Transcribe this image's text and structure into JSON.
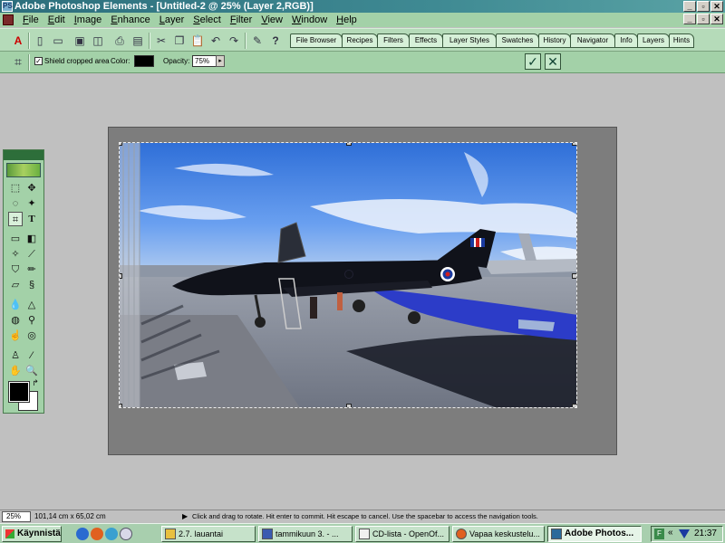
{
  "window": {
    "title": "Adobe Photoshop Elements - [Untitled-2 @ 25% (Layer 2,RGB)]",
    "controls": [
      "_",
      "▫",
      "✕"
    ],
    "doc_controls": [
      "_",
      "▫",
      "✕"
    ]
  },
  "menu": [
    {
      "label": "File",
      "u": "F",
      "rest": "ile"
    },
    {
      "label": "Edit",
      "u": "E",
      "rest": "dit"
    },
    {
      "label": "Image",
      "u": "I",
      "rest": "mage"
    },
    {
      "label": "Enhance",
      "u": "E",
      "rest": "nhance"
    },
    {
      "label": "Layer",
      "u": "L",
      "rest": "ayer"
    },
    {
      "label": "Select",
      "u": "S",
      "rest": "elect"
    },
    {
      "label": "Filter",
      "u": "F",
      "rest": "ilter"
    },
    {
      "label": "View",
      "u": "V",
      "rest": "iew"
    },
    {
      "label": "Window",
      "u": "W",
      "rest": "indow"
    },
    {
      "label": "Help",
      "u": "H",
      "rest": "elp"
    }
  ],
  "palette_tabs": [
    "File Browser",
    "Recipes",
    "Filters",
    "Effects",
    "Layer Styles",
    "Swatches",
    "History",
    "Navigator",
    "Info",
    "Layers",
    "Hints"
  ],
  "options": {
    "shield_checked": true,
    "shield_label": "Shield cropped area",
    "color_label": "Color:",
    "color_value": "#000000",
    "opacity_label": "Opacity:",
    "opacity_value": "75%",
    "commit_icon": "✓",
    "cancel_icon": "✕"
  },
  "status": {
    "zoom": "25%",
    "doc_size": "101,14 cm x 65,02 cm",
    "hint": "Click and drag to rotate. Hit enter to commit. Hit escape to cancel. Use the spacebar to access the navigation tools."
  },
  "taskbar": {
    "start_label": "Käynnistä",
    "tasks": [
      {
        "label": "2.7. lauantai",
        "icon_color": "#e8c040"
      },
      {
        "label": "tammikuun 3. - ...",
        "icon_color": "#3a5ab0"
      },
      {
        "label": "CD-lista - OpenOf...",
        "icon_color": "#f0f0f0"
      },
      {
        "label": "Vapaa keskustelu...",
        "icon_color": "#e06020"
      },
      {
        "label": "Adobe Photos...",
        "icon_color": "#2a6a9a"
      }
    ],
    "clock": "21:37"
  },
  "colors": {
    "titlebar": "#3f8a93",
    "chrome_green": "#a3d1a8",
    "canvas_gray": "#7d7d7d",
    "workspace": "#c0c0c0"
  }
}
